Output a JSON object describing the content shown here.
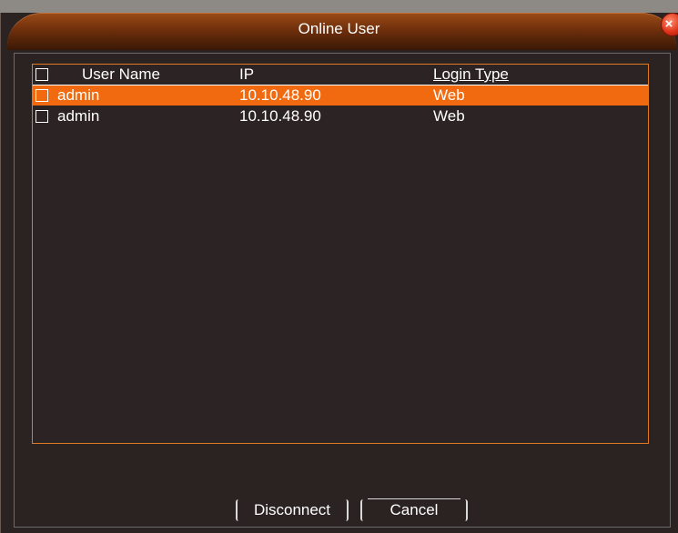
{
  "dialog": {
    "title": "Online User",
    "close_symbol": "×"
  },
  "table": {
    "headers": {
      "user_name": "User Name",
      "ip": "IP",
      "login_type": "Login Type"
    },
    "rows": [
      {
        "user_name": "admin",
        "ip": "10.10.48.90",
        "login_type": "Web",
        "selected": true
      },
      {
        "user_name": "admin",
        "ip": "10.10.48.90",
        "login_type": "Web",
        "selected": false
      }
    ]
  },
  "buttons": {
    "disconnect": "Disconnect",
    "cancel": "Cancel"
  },
  "colors": {
    "accent": "#f26a0f",
    "title_bar": "#6e2f0b",
    "background": "#2a2322"
  },
  "icons": {
    "close": "close-icon",
    "checkbox": "checkbox-icon"
  }
}
